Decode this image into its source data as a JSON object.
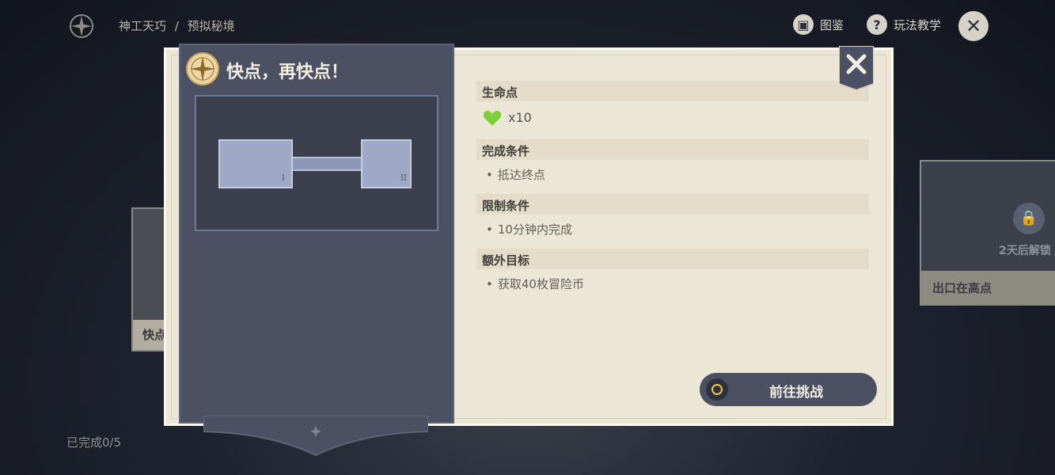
{
  "topbar": {
    "breadcrumb": [
      "神工天巧",
      "预拟秘境"
    ],
    "breadcrumb_sep": "/",
    "handbook_label": "图鉴",
    "tutorial_label": "玩法教学"
  },
  "background": {
    "left_card_label": "快点",
    "right_card_label": "出口在高点",
    "right_card_unlock": "2天后解锁",
    "progress": "已完成0/5"
  },
  "dialog": {
    "title": "快点，再快点！",
    "preview_marks": [
      "I",
      "II"
    ],
    "sections": {
      "life": {
        "title": "生命点",
        "count": "x10"
      },
      "complete": {
        "title": "完成条件",
        "items": [
          "抵达终点"
        ]
      },
      "limit": {
        "title": "限制条件",
        "items": [
          "10分钟内完成"
        ]
      },
      "extra": {
        "title": "额外目标",
        "items": [
          "获取40枚冒险币"
        ]
      }
    },
    "go_button": "前往挑战"
  },
  "colors": {
    "accent": "#f0c445",
    "panel": "#4b5063",
    "paper": "#ece6d6",
    "heart": "#7ed03a"
  },
  "icons": [
    "compass-icon",
    "handbook-icon",
    "question-icon",
    "close-icon",
    "heart-icon",
    "lock-icon"
  ]
}
